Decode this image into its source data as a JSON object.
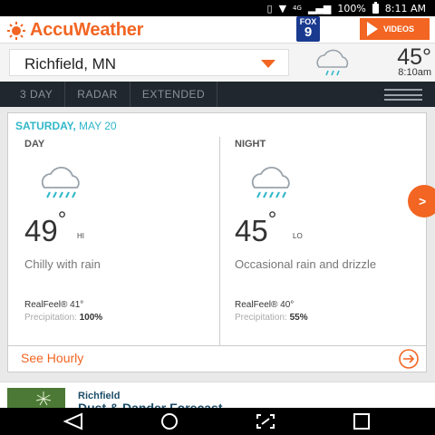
{
  "status_bar": {
    "lte_label": "4G",
    "battery": "100%",
    "time": "8:11 AM"
  },
  "header": {
    "brand": "AccuWeather",
    "partner_logo_top": "FOX",
    "partner_logo_big": "9",
    "videos_label": "VIDEOS"
  },
  "location": {
    "name": "Richfield, MN",
    "current_temp": "45°",
    "current_time": "8:10am",
    "current_icon": "rain-cloud-icon"
  },
  "tabs": [
    {
      "label": "3 DAY"
    },
    {
      "label": "RADAR"
    },
    {
      "label": "EXTENDED"
    }
  ],
  "forecast": {
    "weekday": "SATURDAY,",
    "date": "MAY 20",
    "day": {
      "label": "DAY",
      "temp": "49",
      "degree": "°",
      "hilo": "HI",
      "condition": "Chilly with rain",
      "realfeel": "RealFeel® 41°",
      "precip_label": "Precipitation:",
      "precip_value": "100%",
      "icon": "rain-cloud-icon"
    },
    "night": {
      "label": "NIGHT",
      "temp": "45",
      "degree": "°",
      "hilo": "LO",
      "condition": "Occasional rain and drizzle",
      "realfeel": "RealFeel® 40°",
      "precip_label": "Precipitation:",
      "precip_value": "55%",
      "icon": "rain-cloud-icon"
    },
    "see_hourly": "See Hourly"
  },
  "ad": {
    "title": "Richfield",
    "subtitle": "Dust & Dander Forecast"
  },
  "colors": {
    "accent": "#f26522",
    "date_teal": "#2fb7c9",
    "tab_bg": "#20272f"
  }
}
